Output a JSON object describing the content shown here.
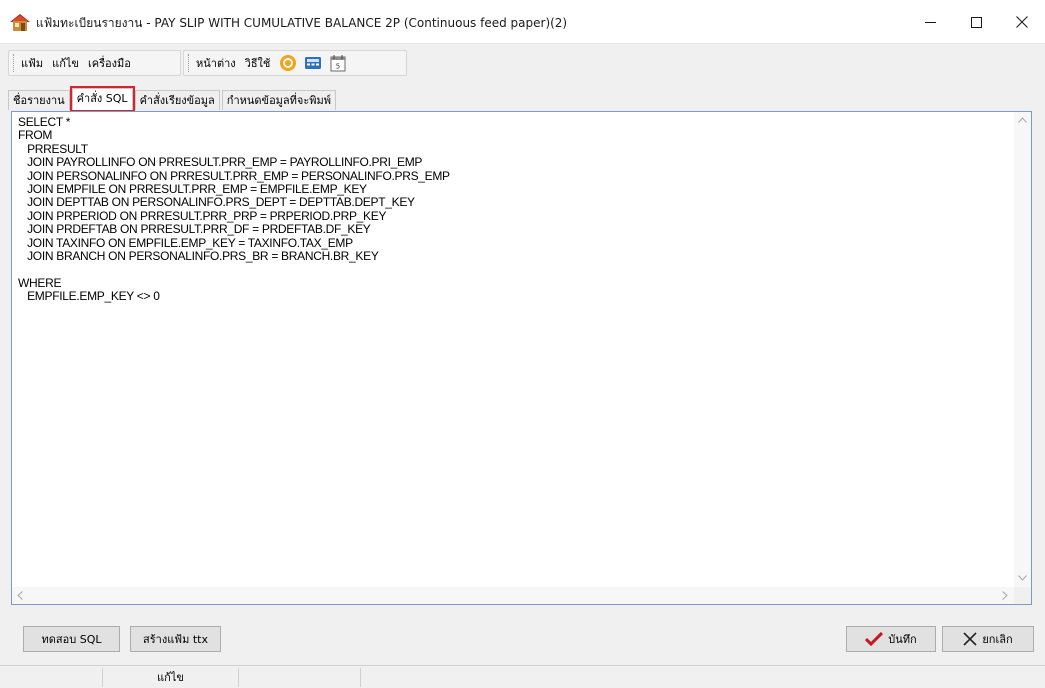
{
  "window": {
    "title": "แฟ้มทะเบียนรายงาน - PAY SLIP WITH CUMULATIVE BALANCE 2P (Continuous feed paper)(2)",
    "app_icon": "house-icon",
    "controls": [
      "minimize-icon",
      "maximize-icon",
      "close-icon"
    ],
    "close_glyph": "✕"
  },
  "toolbar": {
    "menu": [
      "แฟ้ม",
      "แก้ไข",
      "เครื่องมือ"
    ],
    "menu2": [
      "หน้าต่าง",
      "วิธีใช้"
    ],
    "icons": [
      "help-circle-icon",
      "calculator-icon",
      "calendar-icon"
    ]
  },
  "tabs": {
    "items": [
      "ชื่อรายงาน",
      "คำสั่ง SQL",
      "คำสั่งเรียงข้อมูล",
      "กำหนดข้อมูลที่จะพิมพ์"
    ],
    "active_index": 1
  },
  "editor": {
    "sql": "SELECT *\nFROM\n   PRRESULT\n   JOIN PAYROLLINFO ON PRRESULT.PRR_EMP = PAYROLLINFO.PRI_EMP\n   JOIN PERSONALINFO ON PRRESULT.PRR_EMP = PERSONALINFO.PRS_EMP\n   JOIN EMPFILE ON PRRESULT.PRR_EMP = EMPFILE.EMP_KEY\n   JOIN DEPTTAB ON PERSONALINFO.PRS_DEPT = DEPTTAB.DEPT_KEY\n   JOIN PRPERIOD ON PRRESULT.PRR_PRP = PRPERIOD.PRP_KEY\n   JOIN PRDEFTAB ON PRRESULT.PRR_DF = PRDEFTAB.DF_KEY\n   JOIN TAXINFO ON EMPFILE.EMP_KEY = TAXINFO.TAX_EMP\n   JOIN BRANCH ON PERSONALINFO.PRS_BR = BRANCH.BR_KEY\n\nWHERE\n   EMPFILE.EMP_KEY <> 0"
  },
  "buttons": {
    "test_sql": "ทดสอบ SQL",
    "create_ttx": "สร้างแฟ้ม ttx",
    "save": "บันทึก",
    "cancel": "ยกเลิก"
  },
  "statusbar": {
    "mode": "แก้ไข"
  },
  "colors": {
    "highlight": "#d8232a",
    "editor_border": "#7a9bc9",
    "save_check": "#c8161d"
  }
}
